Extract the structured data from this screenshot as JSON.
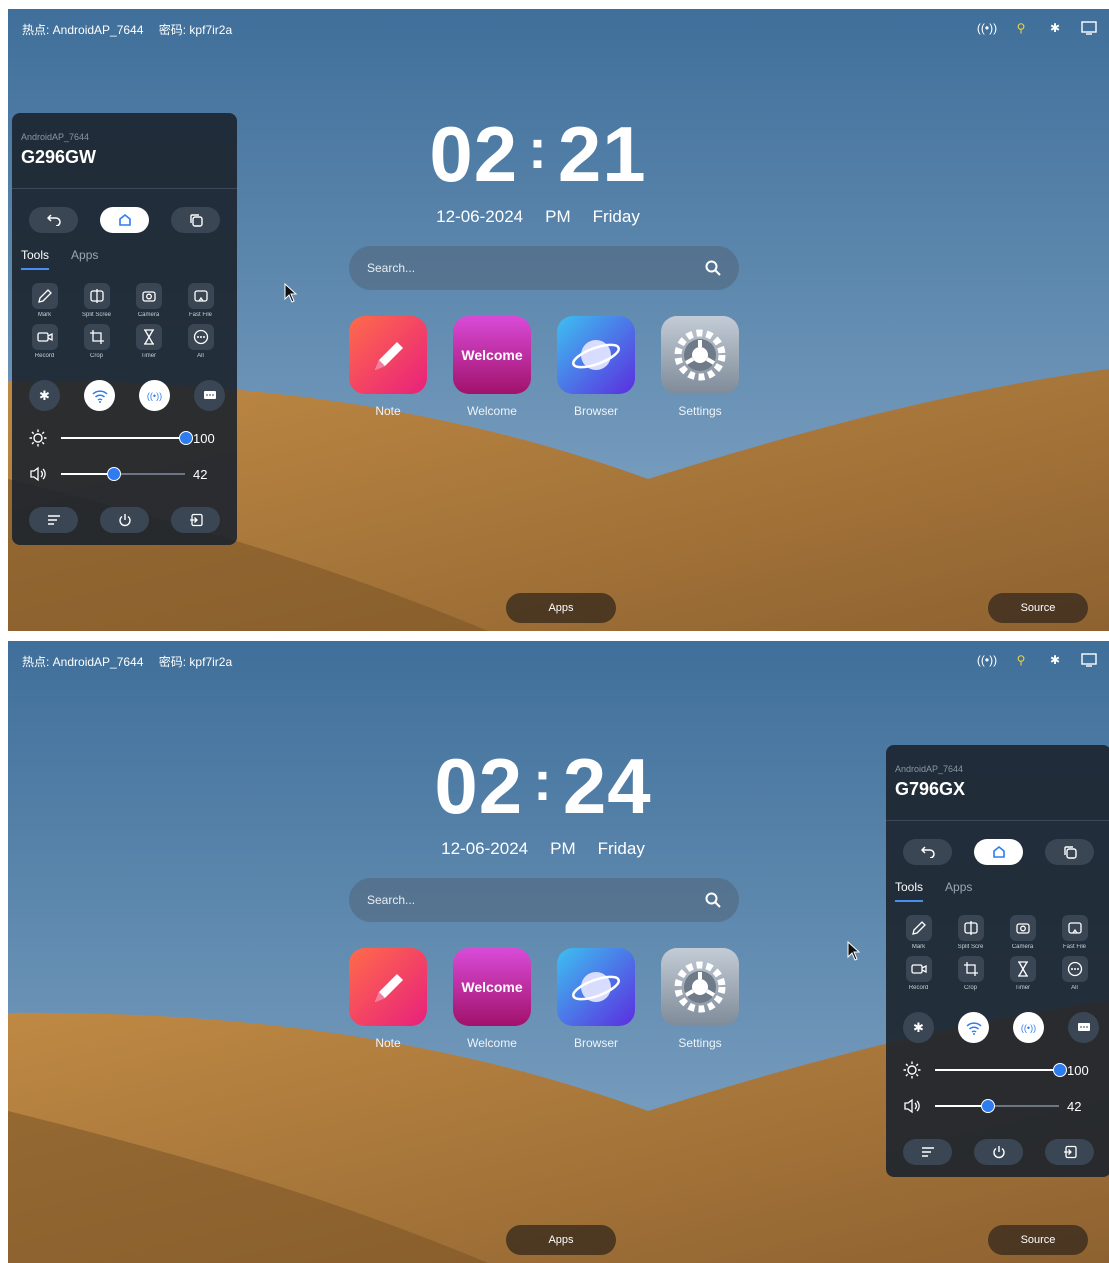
{
  "status_bar": {
    "hotspot": "热点: AndroidAP_7644",
    "password": "密码: kpf7ir2a"
  },
  "search": {
    "placeholder": "Search..."
  },
  "apps": [
    {
      "label": "Note",
      "icon": "pen-icon",
      "color": "#f0405f"
    },
    {
      "label": "Welcome",
      "icon": "welcome-icon",
      "banner": "Welcome",
      "color": "#c2188a"
    },
    {
      "label": "Browser",
      "icon": "planet-icon",
      "color": "#4a55e8"
    },
    {
      "label": "Settings",
      "icon": "gear-icon",
      "color": "#8e9aa8"
    }
  ],
  "dock": {
    "apps_label": "Apps",
    "source_label": "Source"
  },
  "screens": [
    {
      "clock": {
        "hours": "02",
        "colon": ":",
        "minutes": "21",
        "date": "12-06-2024",
        "ampm": "PM",
        "day": "Friday"
      },
      "panel": {
        "ssid": "AndroidAP_7644",
        "device": "G296GW",
        "tabs": [
          "Tools",
          "Apps"
        ],
        "tools": [
          "Mark",
          "Split Scree",
          "Camera",
          "Fast File",
          "Record",
          "Crop",
          "Timer",
          "All"
        ],
        "brightness": 100,
        "volume": 42
      }
    },
    {
      "clock": {
        "hours": "02",
        "colon": ":",
        "minutes": "24",
        "date": "12-06-2024",
        "ampm": "PM",
        "day": "Friday"
      },
      "panel": {
        "ssid": "AndroidAP_7644",
        "device": "G796GX",
        "tabs": [
          "Tools",
          "Apps"
        ],
        "tools": [
          "Mark",
          "Split Scre",
          "Camera",
          "Fast File",
          "Record",
          "Crop",
          "Timer",
          "All"
        ],
        "brightness": 100,
        "volume": 42
      }
    }
  ],
  "colors": {
    "sky_top": "#3f6f9a",
    "sky_bottom": "#7ca3c6",
    "sand": "#b88443",
    "sand_dark": "#8e6230",
    "accent": "#2f7bf0"
  }
}
